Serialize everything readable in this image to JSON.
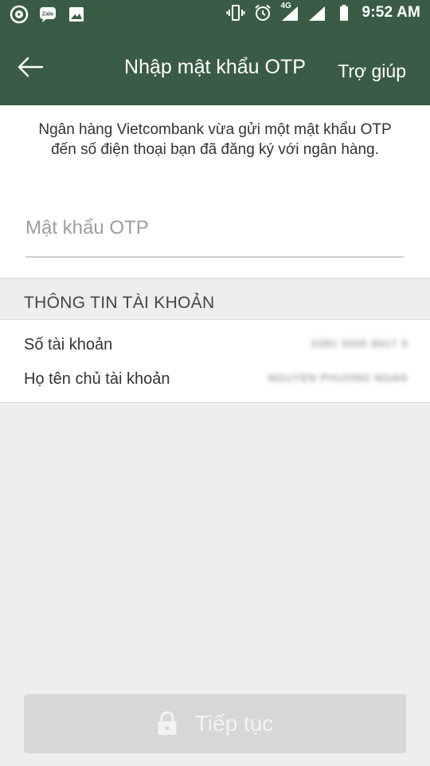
{
  "status_bar": {
    "time": "9:52 AM",
    "network": "4G",
    "left_icons": [
      "play-circle-icon",
      "zalo-icon",
      "image-icon"
    ],
    "right_icons": [
      "vibrate-icon",
      "alarm-icon",
      "signal-icon",
      "battery-icon"
    ]
  },
  "app_bar": {
    "title": "Nhập mật khẩu OTP",
    "help_label": "Trợ giúp"
  },
  "otp": {
    "description": "Ngân hàng Vietcombank vừa gửi một mật khẩu OTP đến số điện thoại bạn đã đăng ký với ngân hàng.",
    "placeholder": "Mật khẩu OTP",
    "value": ""
  },
  "account_info": {
    "header": "THÔNG TIN TÀI KHOẢN",
    "rows": [
      {
        "label": "Số tài khoản",
        "value": "0381 0005 8917 3"
      },
      {
        "label": "Họ tên chủ tài khoản",
        "value": "NGUYEN PHUONG NGAN"
      }
    ]
  },
  "footer": {
    "next_label": "Tiếp tục"
  },
  "colors": {
    "primary": "#3b5c44",
    "background": "#eeeeee",
    "button_disabled": "#d7d7d7"
  }
}
